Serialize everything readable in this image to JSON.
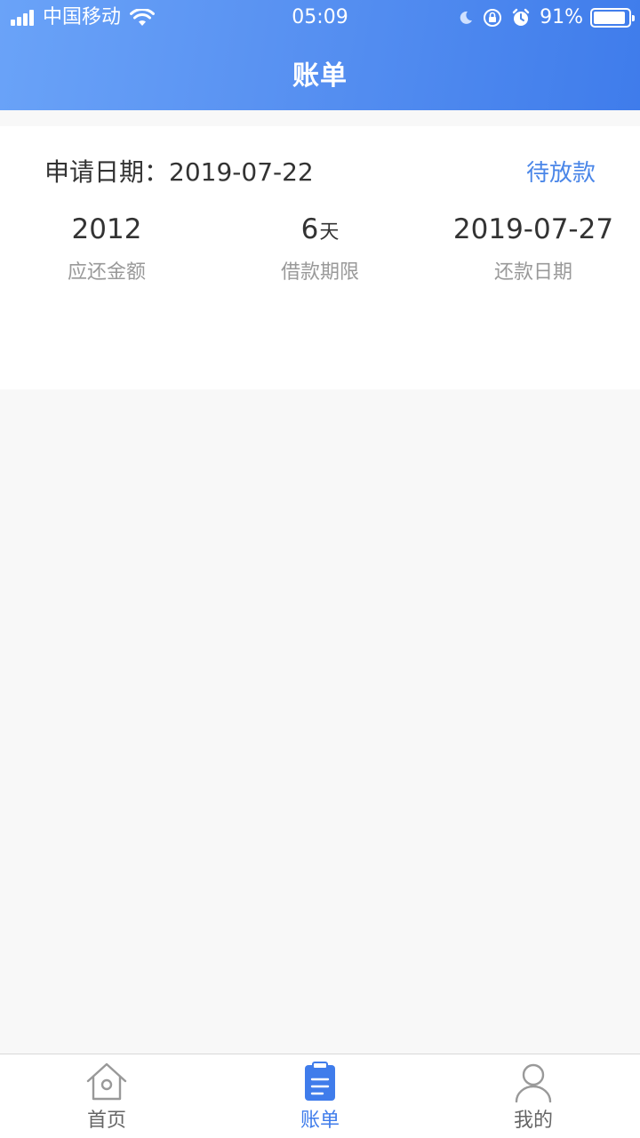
{
  "status_bar": {
    "carrier": "中国移动",
    "time": "05:09",
    "battery_percent": "91%",
    "battery_level": 0.91
  },
  "nav": {
    "title": "账单"
  },
  "bill": {
    "apply_date_label": "申请日期：",
    "apply_date": "2019-07-22",
    "status": "待放款",
    "amount_value": "2012",
    "amount_label": "应还金额",
    "term_value": "6",
    "term_unit": "天",
    "term_label": "借款期限",
    "due_date_value": "2019-07-27",
    "due_date_label": "还款日期"
  },
  "tabs": [
    {
      "label": "首页",
      "icon": "home-icon",
      "active": false
    },
    {
      "label": "账单",
      "icon": "bill-icon",
      "active": true
    },
    {
      "label": "我的",
      "icon": "user-icon",
      "active": false
    }
  ],
  "colors": {
    "accent": "#3f7ceb",
    "header_start": "#6aa3f8",
    "status_text": "#4a86e8",
    "inactive_icon": "#999999"
  }
}
